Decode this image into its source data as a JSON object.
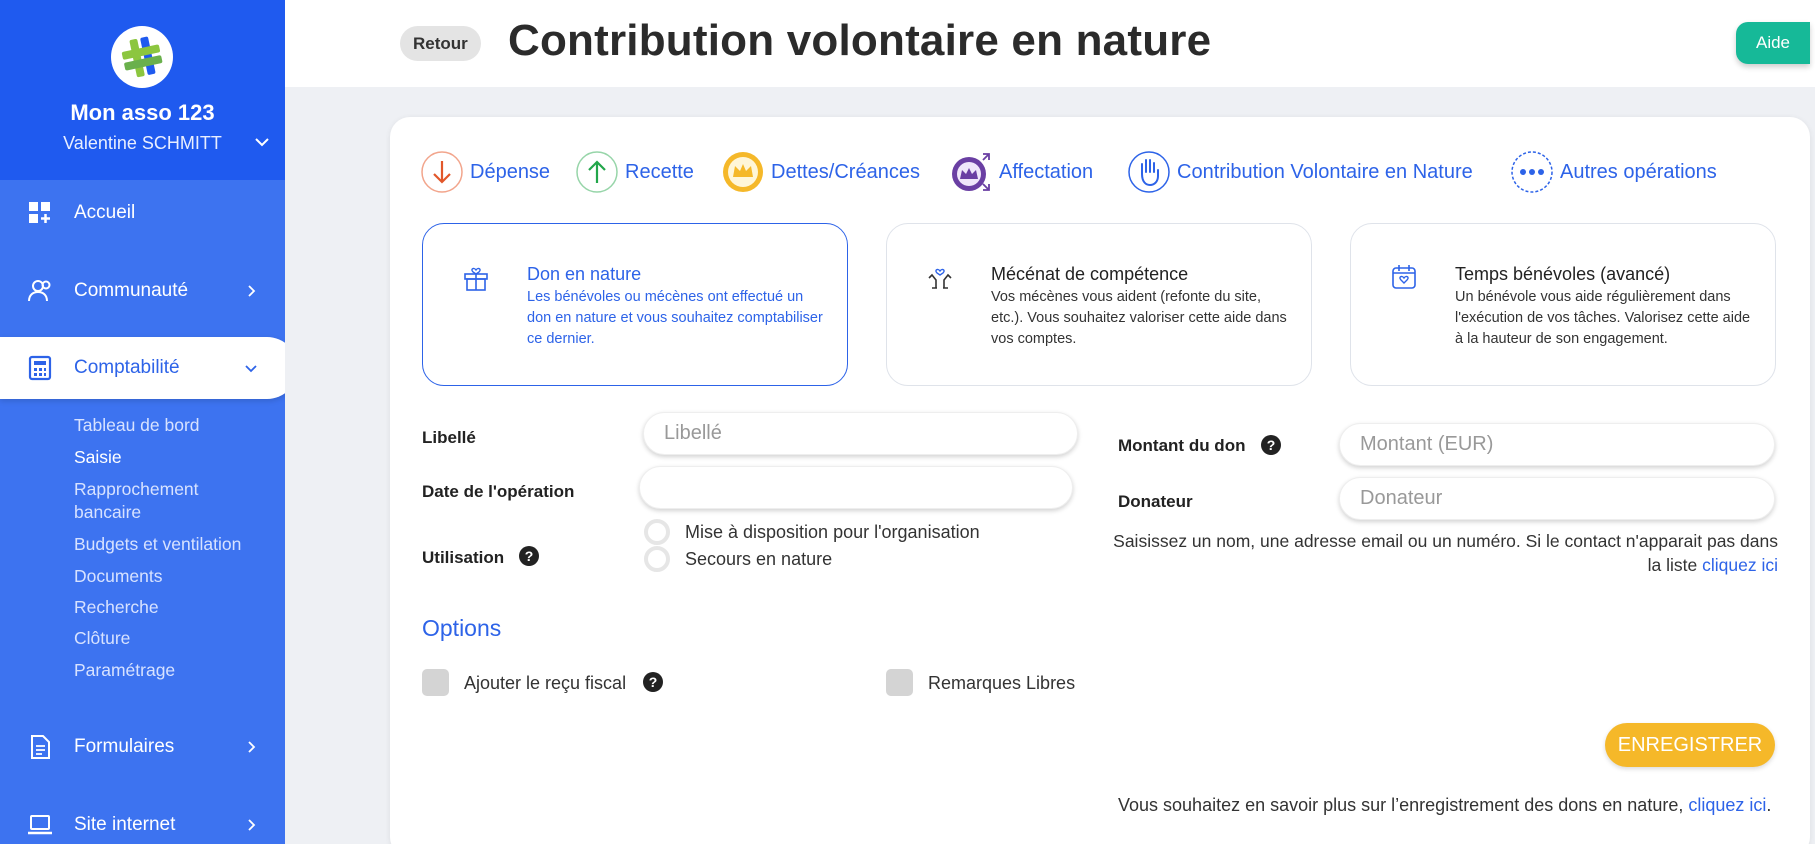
{
  "sidebar": {
    "org_name": "Mon asso 123",
    "user_name": "Valentine SCHMITT",
    "nav": {
      "accueil": "Accueil",
      "communaute": "Communauté",
      "comptabilite": "Comptabilité",
      "formulaires": "Formulaires",
      "site": "Site internet"
    },
    "sub": [
      "Tableau de bord",
      "Saisie",
      "Rapprochement bancaire",
      "Budgets et ventilation",
      "Documents",
      "Recherche",
      "Clôture",
      "Paramétrage"
    ],
    "current_sub": "Saisie"
  },
  "header": {
    "back_label": "Retour",
    "title": "Contribution volontaire en nature",
    "help_label": "Aide"
  },
  "op_tabs": [
    {
      "label": "Dépense",
      "icon": "arrow-down-icon",
      "color": "#e2572a"
    },
    {
      "label": "Recette",
      "icon": "arrow-up-icon",
      "color": "#22a64a"
    },
    {
      "label": "Dettes/Créances",
      "icon": "crown-icon",
      "color": "#f5b829"
    },
    {
      "label": "Affectation",
      "icon": "crown-arrows-icon",
      "color": "#6a3fa3"
    },
    {
      "label": "Contribution Volontaire en Nature",
      "icon": "hand-icon",
      "color": "#2d63e8"
    },
    {
      "label": "Autres opérations",
      "icon": "dots-icon",
      "color": "#2d63e8"
    }
  ],
  "choices": [
    {
      "title": "Don en nature",
      "desc": "Les bénévoles ou mécènes ont effectué un don en nature et vous souhaitez comptabiliser ce dernier.",
      "icon": "gift-icon",
      "selected": true
    },
    {
      "title": "Mécénat de compétence",
      "desc": "Vos mécènes vous aident (refonte du site, etc.). Vous souhaitez valoriser cette aide dans vos comptes.",
      "icon": "hands-heart-icon",
      "selected": false
    },
    {
      "title": "Temps bénévoles (avancé)",
      "desc": "Un bénévole vous aide régulièrement dans l'exécution de vos tâches. Valorisez cette aide à la hauteur de son engagement.",
      "icon": "calendar-heart-icon",
      "selected": false
    }
  ],
  "form": {
    "libelle_label": "Libellé",
    "libelle_placeholder": "Libellé",
    "date_label": "Date de l'opération",
    "date_value": "",
    "utilisation_label": "Utilisation",
    "utilisation_options": [
      "Mise à disposition pour l'organisation",
      "Secours en nature"
    ],
    "montant_label": "Montant du don",
    "montant_placeholder": "Montant (EUR)",
    "donateur_label": "Donateur",
    "donateur_placeholder": "Donateur",
    "hint_text": "Saisissez un nom, une adresse email ou un numéro. Si le contact n'apparait pas dans la liste ",
    "hint_link": "cliquez ici"
  },
  "options": {
    "title": "Options",
    "recu_label": "Ajouter le reçu fiscal",
    "remarques_label": "Remarques Libres"
  },
  "save_label": "ENREGISTRER",
  "footer": {
    "text": "Vous souhaitez en savoir plus sur l’enregistrement des dons en nature, ",
    "link": "cliquez ici",
    "end": "."
  },
  "colors": {
    "sidebar_bg": "#3d73f0",
    "sidebar_head": "#1f5aef",
    "accent": "#2d63e8",
    "help_button": "#16b998",
    "save_button": "#f5b829"
  }
}
